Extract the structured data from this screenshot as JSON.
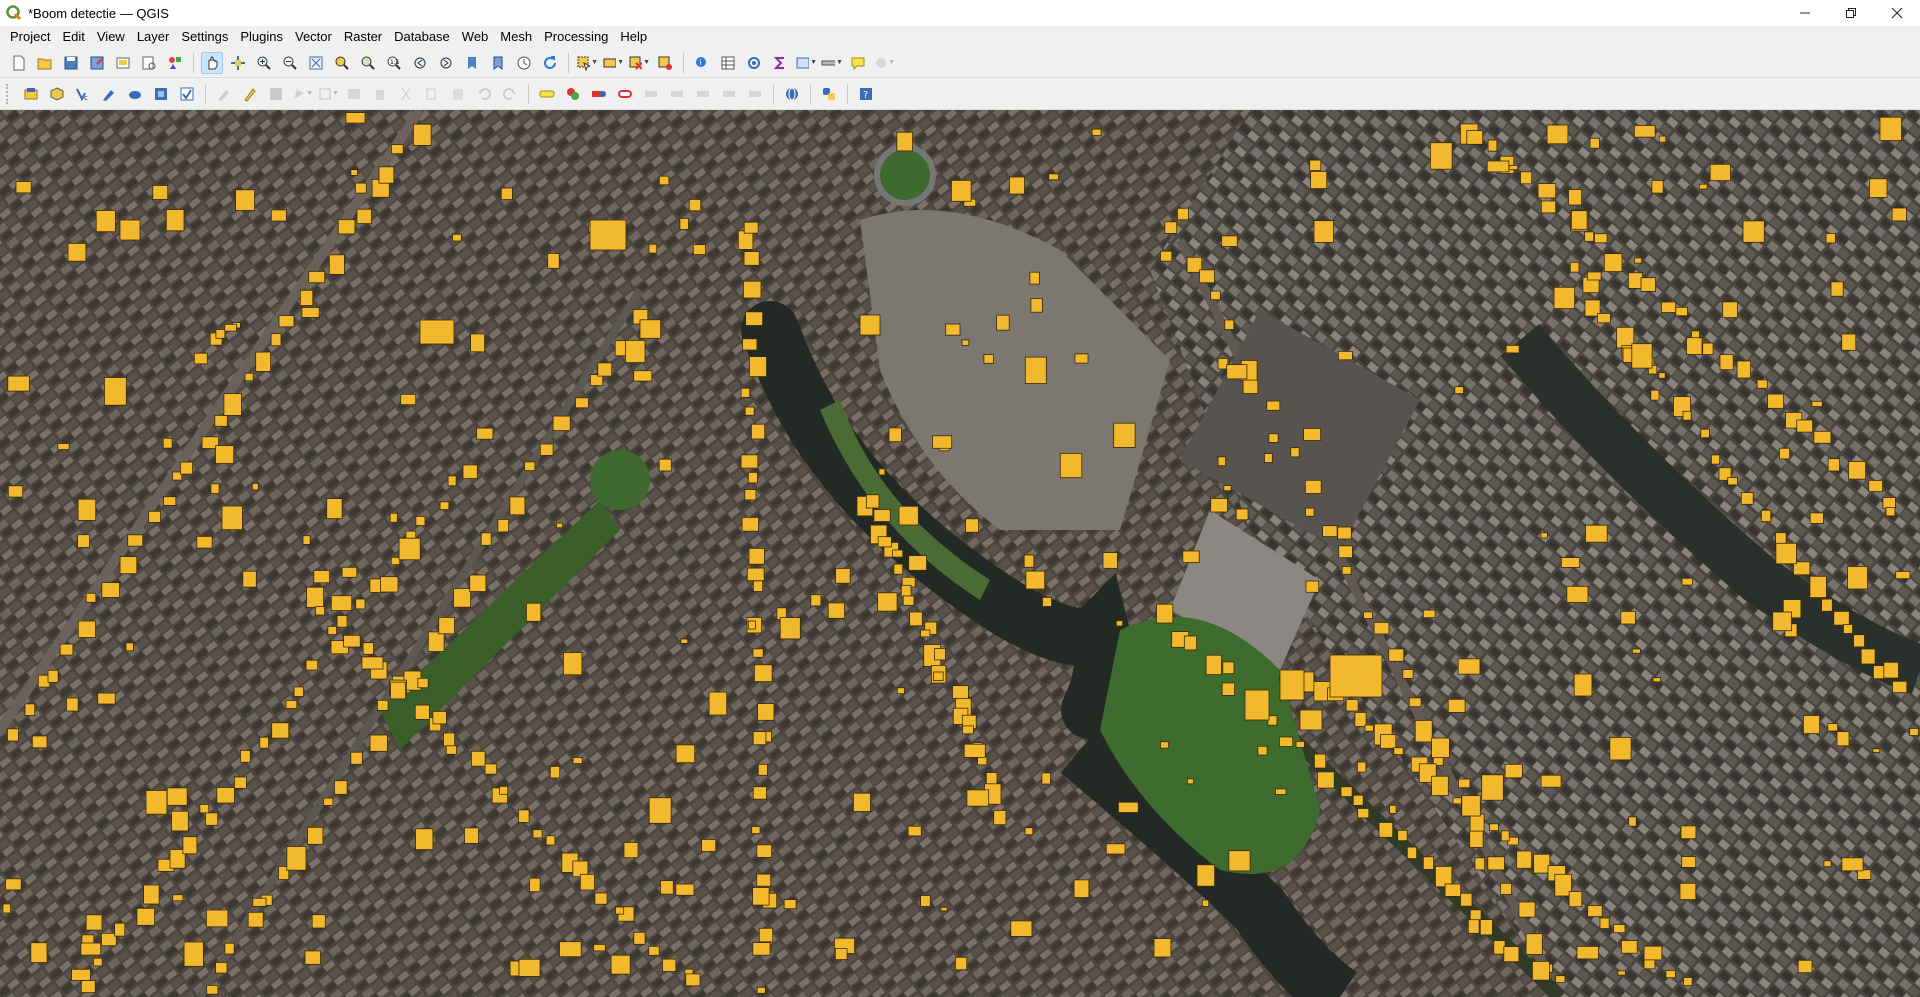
{
  "window": {
    "title": "*Boom detectie — QGIS",
    "controls": [
      "minimize",
      "maximize",
      "close"
    ]
  },
  "menu": [
    "Project",
    "Edit",
    "View",
    "Layer",
    "Settings",
    "Plugins",
    "Vector",
    "Raster",
    "Database",
    "Web",
    "Mesh",
    "Processing",
    "Help"
  ],
  "toolbar_icons": {
    "row1": [
      "new-project-icon",
      "open-project-icon",
      "save-project-icon",
      "save-as-icon",
      "print-layout-icon",
      "layout-manager-icon",
      "style-manager-icon",
      "pan-icon",
      "pan-to-selection-icon",
      "zoom-in-icon",
      "zoom-out-icon",
      "zoom-full-icon",
      "zoom-selection-icon",
      "zoom-layer-icon",
      "zoom-native-icon",
      "zoom-last-icon",
      "zoom-next-icon",
      "new-bookmark-icon",
      "show-bookmarks-icon",
      "temporal-icon",
      "refresh-icon",
      "select-features-icon",
      "select-value-icon",
      "deselect-icon",
      "identify-icon",
      "attribute-table-icon",
      "statistics-icon",
      "sum-icon",
      "field-calculator-icon",
      "measure-icon",
      "map-tips-icon",
      "annotation-icon"
    ],
    "row2": [
      "data-source-manager-icon",
      "new-geopackage-icon",
      "new-vector-layer-icon",
      "digitize-icon",
      "virtual-layer-icon",
      "temporary-layer-icon",
      "wms-layer-icon",
      "current-edits-icon",
      "toggle-editing-icon",
      "save-edits-icon",
      "add-feature-icon",
      "vertex-tool-icon",
      "delete-icon",
      "cut-icon",
      "copy-icon",
      "paste-icon",
      "undo-icon",
      "redo-icon",
      "label-icon",
      "diagram-icon",
      "pin-label-icon",
      "show-label-icon",
      "move-label-icon",
      "rotate-label-icon",
      "change-label-icon",
      "python-icon",
      "help-icon"
    ]
  },
  "colors": {
    "tree_marker": "#f2b82e",
    "tree_marker_stroke": "#3a2a00",
    "water": "#232a26",
    "grass": "#3e6b2e",
    "roof_light": "#8a8680",
    "road": "#5e5852"
  },
  "map": {
    "layer": "Boom detectie"
  }
}
